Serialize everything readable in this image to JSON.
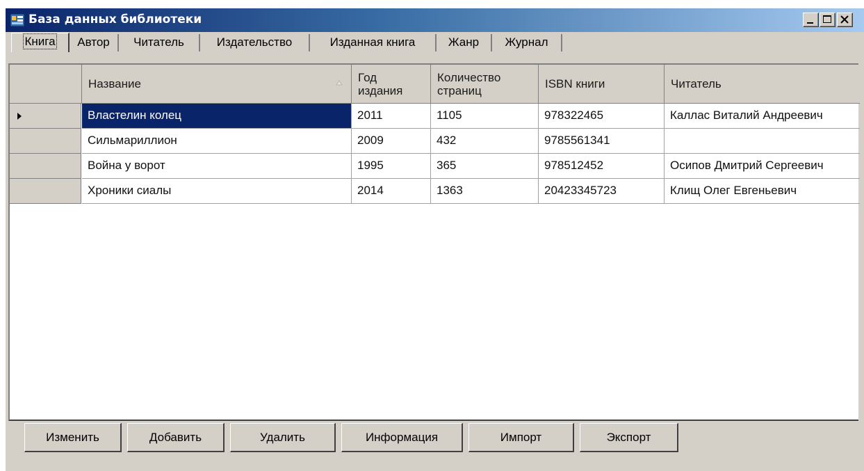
{
  "window": {
    "title": "База данных библиотеки"
  },
  "tabs": [
    {
      "label": "Книга",
      "active": true
    },
    {
      "label": "Автор",
      "active": false
    },
    {
      "label": "Читатель",
      "active": false
    },
    {
      "label": "Издательство",
      "active": false
    },
    {
      "label": "Изданная книга",
      "active": false
    },
    {
      "label": "Жанр",
      "active": false
    },
    {
      "label": "Журнал",
      "active": false
    }
  ],
  "table": {
    "columns": [
      "Название",
      "Год\nиздания",
      "Количество\nстраниц",
      "ISBN книги",
      "Читатель"
    ],
    "sort_column": "Название",
    "sort_direction": "ascending",
    "rows": [
      {
        "title": "Властелин колец",
        "year": "2011",
        "pages": "1105",
        "isbn": "978322465",
        "reader": "Каллас Виталий Андреевич",
        "current": true
      },
      {
        "title": "Сильмариллион",
        "year": "2009",
        "pages": "432",
        "isbn": "9785561341",
        "reader": "",
        "current": false
      },
      {
        "title": "Война у ворот",
        "year": "1995",
        "pages": "365",
        "isbn": "978512452",
        "reader": "Осипов Дмитрий Сергеевич",
        "current": false
      },
      {
        "title": "Хроники сиалы",
        "year": "2014",
        "pages": "1363",
        "isbn": "20423345723",
        "reader": "Клищ Олег Евгеньевич",
        "current": false
      }
    ]
  },
  "buttons": {
    "edit": "Изменить",
    "add": "Добавить",
    "delete": "Удалить",
    "info": "Информация",
    "import": "Импорт",
    "export": "Экспорт"
  },
  "colors": {
    "titlebar_start": "#0a246a",
    "titlebar_end": "#a6caf0",
    "selection": "#0a246a",
    "face": "#d4d0c8"
  }
}
